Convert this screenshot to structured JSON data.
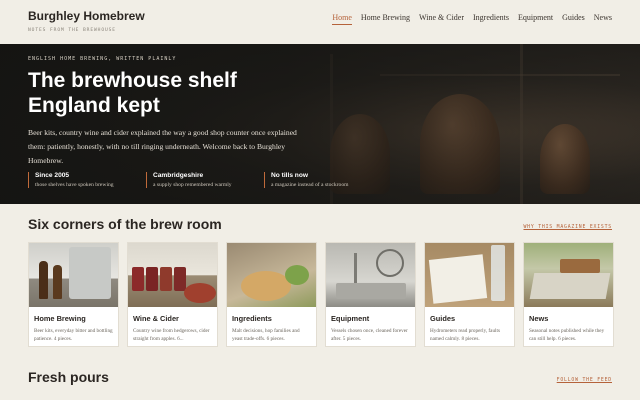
{
  "site": {
    "brand": "Burghley Homebrew",
    "tagline": "NOTES FROM THE BREWHOUSE"
  },
  "nav": [
    {
      "label": "Home",
      "active": true
    },
    {
      "label": "Home Brewing",
      "active": false
    },
    {
      "label": "Wine & Cider",
      "active": false
    },
    {
      "label": "Ingredients",
      "active": false
    },
    {
      "label": "Equipment",
      "active": false
    },
    {
      "label": "Guides",
      "active": false
    },
    {
      "label": "News",
      "active": false
    }
  ],
  "hero": {
    "eyebrow": "ENGLISH HOME BREWING, WRITTEN PLAINLY",
    "title": "The brewhouse shelf England kept",
    "intro": "Beer kits, country wine and cider explained the way a good shop counter once explained them: patiently, honestly, with no till ringing underneath. Welcome back to Burghley Homebrew.",
    "stats": [
      {
        "title": "Since 2005",
        "text": "those shelves have spoken brewing"
      },
      {
        "title": "Cambridgeshire",
        "text": "a supply shop remembered warmly"
      },
      {
        "title": "No tills now",
        "text": "a magazine instead of a stockroom"
      }
    ]
  },
  "corners": {
    "title": "Six corners of the brew room",
    "link": "WHY THIS MAGAZINE EXISTS",
    "cards": [
      {
        "title": "Home Brewing",
        "text": "Beer kits, everyday bitter and bottling patience. 4 pieces.",
        "image": "bottles-and-fermenter"
      },
      {
        "title": "Wine & Cider",
        "text": "Country wine from hedgerows, cider straight from apples. 6...",
        "image": "jars-and-apples"
      },
      {
        "title": "Ingredients",
        "text": "Malt decisions, hop families and yeast trade-offs. 6 pieces.",
        "image": "malt-and-hops"
      },
      {
        "title": "Equipment",
        "text": "Vessels chosen once, cleaned forever after. 5 pieces.",
        "image": "sink-and-tubing"
      },
      {
        "title": "Guides",
        "text": "Hydrometers read properly, faults named calmly. 8 pieces.",
        "image": "notebook-and-hydrometer"
      },
      {
        "title": "News",
        "text": "Seasonal notes published while they can still help. 6 pieces.",
        "image": "garden-table"
      }
    ]
  },
  "fresh": {
    "title": "Fresh pours",
    "link": "FOLLOW THE FEED"
  },
  "colors": {
    "accent": "#b5623a",
    "background": "#f1eee6",
    "hero_dark": "#1c1a17"
  }
}
